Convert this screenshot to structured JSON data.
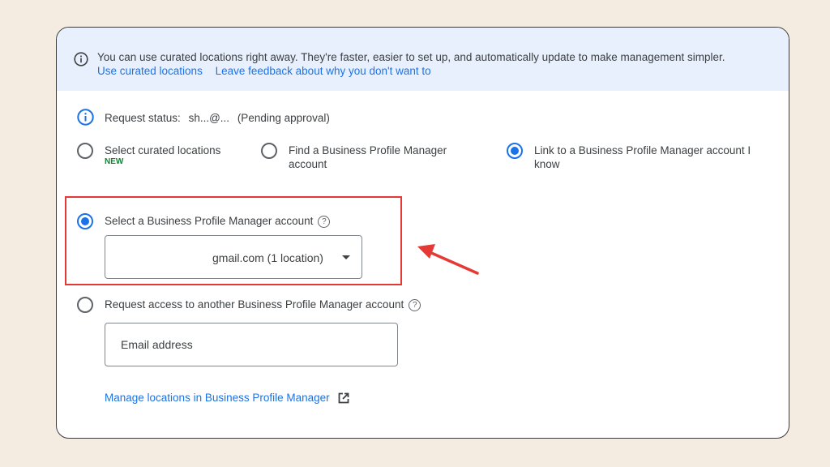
{
  "banner": {
    "message": "You can use curated locations right away. They're faster, easier to set up, and automatically update to make management simpler.",
    "link_curated": "Use curated locations",
    "link_feedback": "Leave feedback about why you don't want to"
  },
  "status": {
    "label": "Request status:",
    "account": "sh...@...",
    "state": "(Pending approval)"
  },
  "options": [
    {
      "label": "Select curated locations",
      "badge": "NEW",
      "selected": false
    },
    {
      "label": "Find a Business Profile Manager account",
      "selected": false
    },
    {
      "label": "Link to a Business Profile Manager account I know",
      "selected": true
    }
  ],
  "select_account": {
    "label": "Select a Business Profile Manager account",
    "help": "?",
    "value": "gmail.com (1 location)",
    "selected": true
  },
  "request_access": {
    "label": "Request access to another Business Profile Manager account",
    "help": "?",
    "placeholder": "Email address",
    "selected": false
  },
  "manage_link": "Manage locations in Business Profile Manager",
  "colors": {
    "accent": "#1a73e8",
    "banner_bg": "#e8f0fe",
    "new_badge": "#188038",
    "highlight": "#e53935",
    "page_bg": "#f4ece0"
  }
}
